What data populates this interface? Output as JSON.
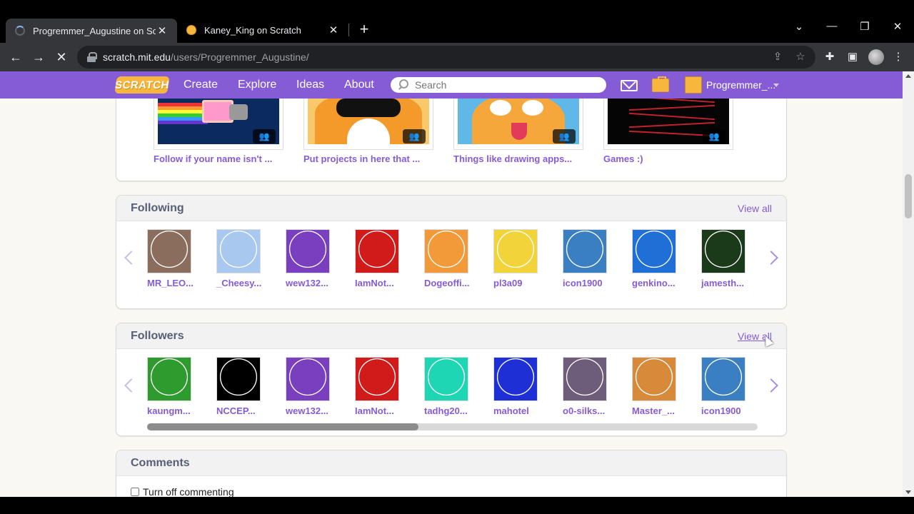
{
  "browser": {
    "tabs": [
      {
        "title": "Progremmer_Augustine on Scrat",
        "active": true
      },
      {
        "title": "Kaney_King on Scratch",
        "active": false
      }
    ],
    "tab_close": "✕",
    "new_tab": "+",
    "url_host": "scratch.mit.edu",
    "url_path": "/users/Progremmer_Augustine/",
    "window_controls": {
      "dropdown": "⌄",
      "minimize": "—",
      "restore": "❐",
      "close": "✕"
    },
    "nav": {
      "back": "←",
      "forward": "→",
      "stop": "✕"
    },
    "toolbar_icons": {
      "share": "⇪",
      "star": "☆",
      "extensions": "✚",
      "sidepanel": "▣",
      "menu": "⋮"
    }
  },
  "scratch_nav": {
    "logo": "SCRATCH",
    "links": [
      "Create",
      "Explore",
      "Ideas",
      "About"
    ],
    "search_placeholder": "Search",
    "username": "Progremmer_..."
  },
  "studios": [
    {
      "label": "Follow if your name isn't ..."
    },
    {
      "label": "Put projects in here that ..."
    },
    {
      "label": "Things like drawing apps..."
    },
    {
      "label": "Games :)"
    }
  ],
  "following": {
    "title": "Following",
    "view_all": "View all",
    "users": [
      {
        "name": "MR_LEO...",
        "color": "#8a6d5c"
      },
      {
        "name": "_Cheesy...",
        "color": "#a8c8ef"
      },
      {
        "name": "wew132...",
        "color": "#7a3fbf"
      },
      {
        "name": "IamNot...",
        "color": "#d11a1a"
      },
      {
        "name": "Dogeoffi...",
        "color": "#f29a3a"
      },
      {
        "name": "pl3a09",
        "color": "#f2d43a"
      },
      {
        "name": "icon1900",
        "color": "#3a7fc2"
      },
      {
        "name": "genkino...",
        "color": "#1f6fd6"
      },
      {
        "name": "jamesth...",
        "color": "#1a3a1a"
      }
    ]
  },
  "followers": {
    "title": "Followers",
    "view_all": "View all",
    "users": [
      {
        "name": "kaungm...",
        "color": "#2e9b2e"
      },
      {
        "name": "NCCEP...",
        "color": "#000000"
      },
      {
        "name": "wew132...",
        "color": "#7a3fbf"
      },
      {
        "name": "IamNot...",
        "color": "#d11a1a"
      },
      {
        "name": "tadhg20...",
        "color": "#1fd6b4"
      },
      {
        "name": "mahotel",
        "color": "#1f2fd6"
      },
      {
        "name": "o0-silks...",
        "color": "#6d5c7a"
      },
      {
        "name": "Master_...",
        "color": "#d68a3a"
      },
      {
        "name": "icon1900",
        "color": "#3a7fc2"
      }
    ]
  },
  "comments": {
    "title": "Comments",
    "toggle_label": "Turn off commenting"
  },
  "colors": {
    "scratch_purple": "#855cd6",
    "scratch_orange": "#f6b73c",
    "heading_gray": "#575e75"
  }
}
